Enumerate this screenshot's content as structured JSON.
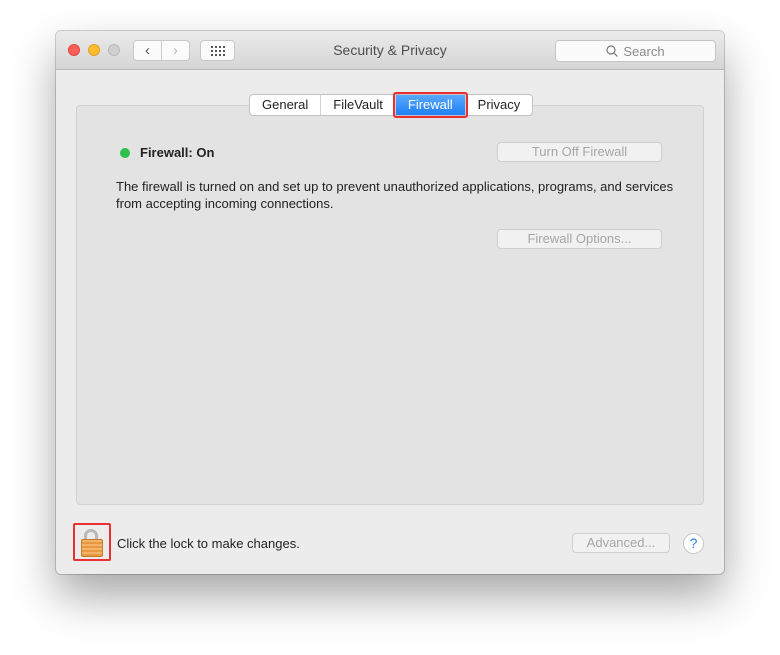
{
  "window": {
    "title": "Security & Privacy",
    "search_placeholder": "Search"
  },
  "toolbar": {
    "back_icon": "chevron-left-icon",
    "forward_icon": "chevron-right-icon",
    "grid_icon": "grid-icon"
  },
  "tabs": [
    {
      "label": "General",
      "active": false
    },
    {
      "label": "FileVault",
      "active": false
    },
    {
      "label": "Firewall",
      "active": true
    },
    {
      "label": "Privacy",
      "active": false
    }
  ],
  "firewall": {
    "status_label": "Firewall: On",
    "status_color": "#2bc14a",
    "description": "The firewall is turned on and set up to prevent unauthorized applications, programs, and services from accepting incoming connections.",
    "turn_off_button": "Turn Off Firewall",
    "options_button": "Firewall Options..."
  },
  "footer": {
    "lock_text": "Click the lock to make changes.",
    "advanced_button": "Advanced...",
    "help_label": "?"
  },
  "colors": {
    "accent": "#1f7ff5",
    "highlight": "#ea2f2f"
  }
}
